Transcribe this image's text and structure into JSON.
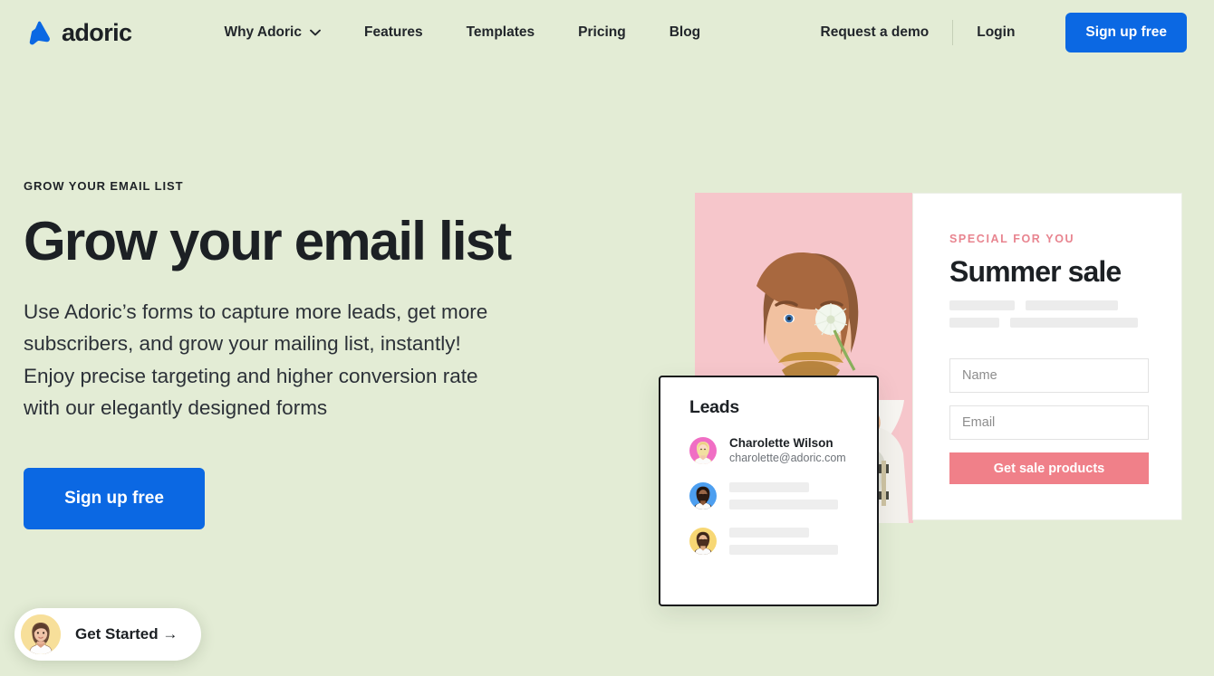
{
  "brand": {
    "name": "adoric",
    "logo_icon": "adoric-triangle-logo",
    "accent_blue": "#0b68e3"
  },
  "nav": {
    "main": [
      {
        "label": "Why Adoric",
        "has_dropdown": true,
        "icon": "chevron-down-icon"
      },
      {
        "label": "Features",
        "has_dropdown": false
      },
      {
        "label": "Templates",
        "has_dropdown": false
      },
      {
        "label": "Pricing",
        "has_dropdown": false
      },
      {
        "label": "Blog",
        "has_dropdown": false
      }
    ],
    "right": {
      "request_demo": "Request a demo",
      "login": "Login",
      "signup": "Sign up free"
    }
  },
  "hero": {
    "eyebrow": "GROW YOUR EMAIL LIST",
    "title": "Grow your email list",
    "subtitle": "Use Adoric’s forms to capture more leads, get more subscribers, and grow your mailing list, instantly! Enjoy precise targeting and higher conversion rate with our elegantly designed forms",
    "cta": "Sign up free"
  },
  "get_started_widget": {
    "label": "Get Started →",
    "avatar_icon": "woman-avatar-icon"
  },
  "promo_popup": {
    "kicker": "SPECIAL FOR YOU",
    "kicker_color": "#e8848f",
    "title": "Summer sale",
    "name_placeholder": "Name",
    "email_placeholder": "Email",
    "name_value": "",
    "email_value": "",
    "cta": "Get sale products",
    "cta_color": "#f08089",
    "photo_alt": "man-with-dandelion-photo"
  },
  "leads_card": {
    "title": "Leads",
    "rows": [
      {
        "name": "Charolette Wilson",
        "email": "charolette@adoric.com",
        "avatar_bg": "#f06ec4",
        "redacted": false
      },
      {
        "name": "",
        "email": "",
        "avatar_bg": "#4d9ff0",
        "redacted": true
      },
      {
        "name": "",
        "email": "",
        "avatar_bg": "#f7d774",
        "redacted": true
      }
    ]
  },
  "theme": {
    "page_bg": "#e3ecd5",
    "text_dark": "#1c2024"
  }
}
